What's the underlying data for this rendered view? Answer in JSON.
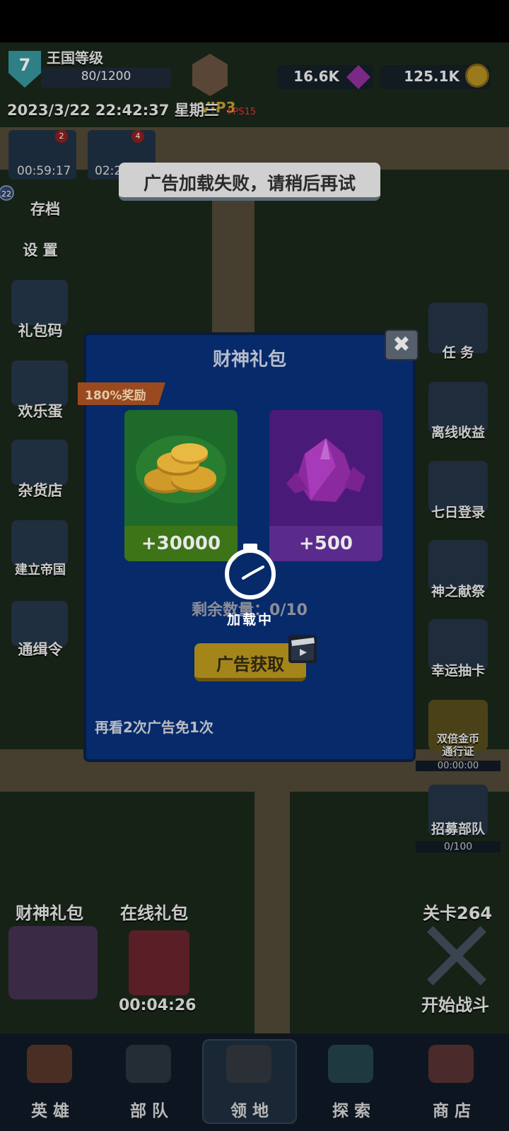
{
  "hud": {
    "kingdom_level": "7",
    "kingdom_title": "王国等级",
    "kingdom_progress": "80/1200",
    "vip_text": "VIP3",
    "fps": "FPS15",
    "datetime": "2023/3/22 22:42:37 星期三",
    "gems": "16.6K",
    "coins": "125.1K"
  },
  "timers": [
    {
      "time": "00:59:17",
      "badge": "2"
    },
    {
      "time": "02:2",
      "badge": "4"
    }
  ],
  "toast": "广告加载失败，请稍后再试",
  "left_menu": {
    "side_counter": "22",
    "save": "存档",
    "settings": "设 置",
    "gift_code": "礼包码",
    "happy_egg": "欢乐蛋",
    "grocery": "杂货店",
    "build_empire": "建立帝国",
    "wanted": "通缉令"
  },
  "right_menu": {
    "tasks": "任 务",
    "offline": "离线收益",
    "seven_day": "七日登录",
    "sacrifice": "神之献祭",
    "lucky_draw": "幸运抽卡",
    "double_coin_1": "双倍金币",
    "double_coin_2": "通行证",
    "double_coin_timer": "00:00:00",
    "recruit": "招募部队",
    "recruit_progress": "0/100"
  },
  "bottom_gifts": {
    "wealth_gift": "财神礼包",
    "online_gift": "在线礼包",
    "online_timer": "00:04:26",
    "stage": "关卡264",
    "start_battle": "开始战斗"
  },
  "nav": {
    "heroes": "英 雄",
    "troops": "部 队",
    "territory": "领 地",
    "explore": "探 索",
    "shop": "商 店"
  },
  "modal": {
    "title": "财神礼包",
    "close": "✖",
    "bonus_ribbon": "180%奖励",
    "coin_amount": "+30000",
    "gem_amount": "+500",
    "remaining": "剩余数量：0/10",
    "ad_button": "广告获取",
    "footnote": "再看2次广告免1次"
  },
  "loading": {
    "text": "加载中"
  },
  "colors": {
    "modal_bg": "#072a6a",
    "coin_card": "#1e6a2a",
    "gem_card": "#4a1a78",
    "ad_button": "#a4851a",
    "ribbon": "#9a4a1e"
  }
}
